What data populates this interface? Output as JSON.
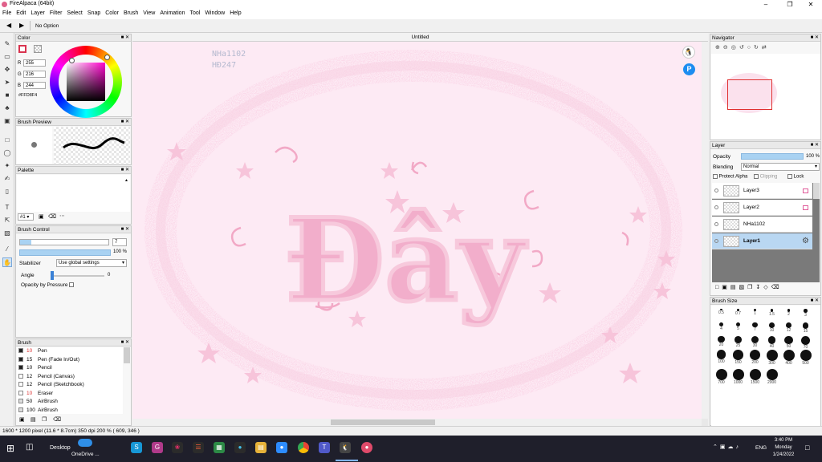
{
  "window": {
    "title": "FireAlpaca (64bit)"
  },
  "menu": [
    "File",
    "Edit",
    "Layer",
    "Filter",
    "Select",
    "Snap",
    "Color",
    "Brush",
    "View",
    "Animation",
    "Tool",
    "Window",
    "Help"
  ],
  "toolbar": {
    "option": "No Option"
  },
  "color_panel": {
    "title": "Color",
    "r_label": "R",
    "g_label": "G",
    "b_label": "B",
    "r": "255",
    "g": "216",
    "b": "244",
    "hex": "#FFD8F4"
  },
  "brush_preview": {
    "title": "Brush Preview"
  },
  "palette": {
    "title": "Palette",
    "selector": "#1"
  },
  "brush_control": {
    "title": "Brush Control",
    "size": "7",
    "opacity": "100 %",
    "stabilizer_label": "Stabilizer",
    "stabilizer_value": "Use global settings",
    "angle_label": "Angle",
    "angle_value": "0",
    "opacity_pressure_label": "Opacity by Pressure"
  },
  "brush_panel": {
    "title": "Brush",
    "items": [
      {
        "size": "10",
        "name": "Pen",
        "red": true
      },
      {
        "size": "15",
        "name": "Pen (Fade In/Out)",
        "red": false
      },
      {
        "size": "10",
        "name": "Pencil",
        "red": false
      },
      {
        "size": "12",
        "name": "Pencil (Canvas)",
        "red": false
      },
      {
        "size": "12",
        "name": "Pencil (Sketchbook)",
        "red": false
      },
      {
        "size": "10",
        "name": "Eraser",
        "red": true
      },
      {
        "size": "50",
        "name": "AirBrush",
        "red": false
      },
      {
        "size": "100",
        "name": "AirBrush",
        "red": false
      }
    ]
  },
  "document": {
    "tab": "Untitled",
    "watermark_line1": "NHa1102",
    "watermark_line2": "HĐ247",
    "artwork_text": "Đây"
  },
  "navigator": {
    "title": "Navigator"
  },
  "layer_panel": {
    "title": "Layer",
    "opacity_label": "Opacity",
    "opacity_value": "100 %",
    "blending_label": "Blending",
    "blending_value": "Normal",
    "protect_alpha": "Protect Alpha",
    "clipping": "Clipping",
    "lock": "Lock",
    "layers": [
      {
        "name": "Layer3",
        "selected": false
      },
      {
        "name": "Layer2",
        "selected": false
      },
      {
        "name": "NHa1102",
        "selected": false
      },
      {
        "name": "Layer1",
        "selected": true
      }
    ]
  },
  "brush_size": {
    "title": "Brush Size",
    "sizes": [
      "0.5",
      "0.7",
      "1",
      "1.5",
      "2",
      "3",
      "4",
      "5",
      "7",
      "10",
      "12",
      "15",
      "20",
      "25",
      "30",
      "40",
      "50",
      "70",
      "100",
      "150",
      "200",
      "300",
      "400",
      "500",
      "700",
      "1000",
      "1500",
      "2000"
    ]
  },
  "status": {
    "text": "1600 * 1200 pixel  (11.6 * 8.7cm)  350 dpi  200 %  ( 609, 346 )"
  },
  "taskbar": {
    "desktop": "Desktop",
    "onedrive": "OneDrive ...",
    "lang": "ENG",
    "time": "3:40 PM",
    "day": "Monday",
    "date": "1/24/2022"
  },
  "colors": {
    "accent": "#7aa8d8",
    "canvas": "#fdeaf4",
    "pink": "#f4b6cf"
  }
}
